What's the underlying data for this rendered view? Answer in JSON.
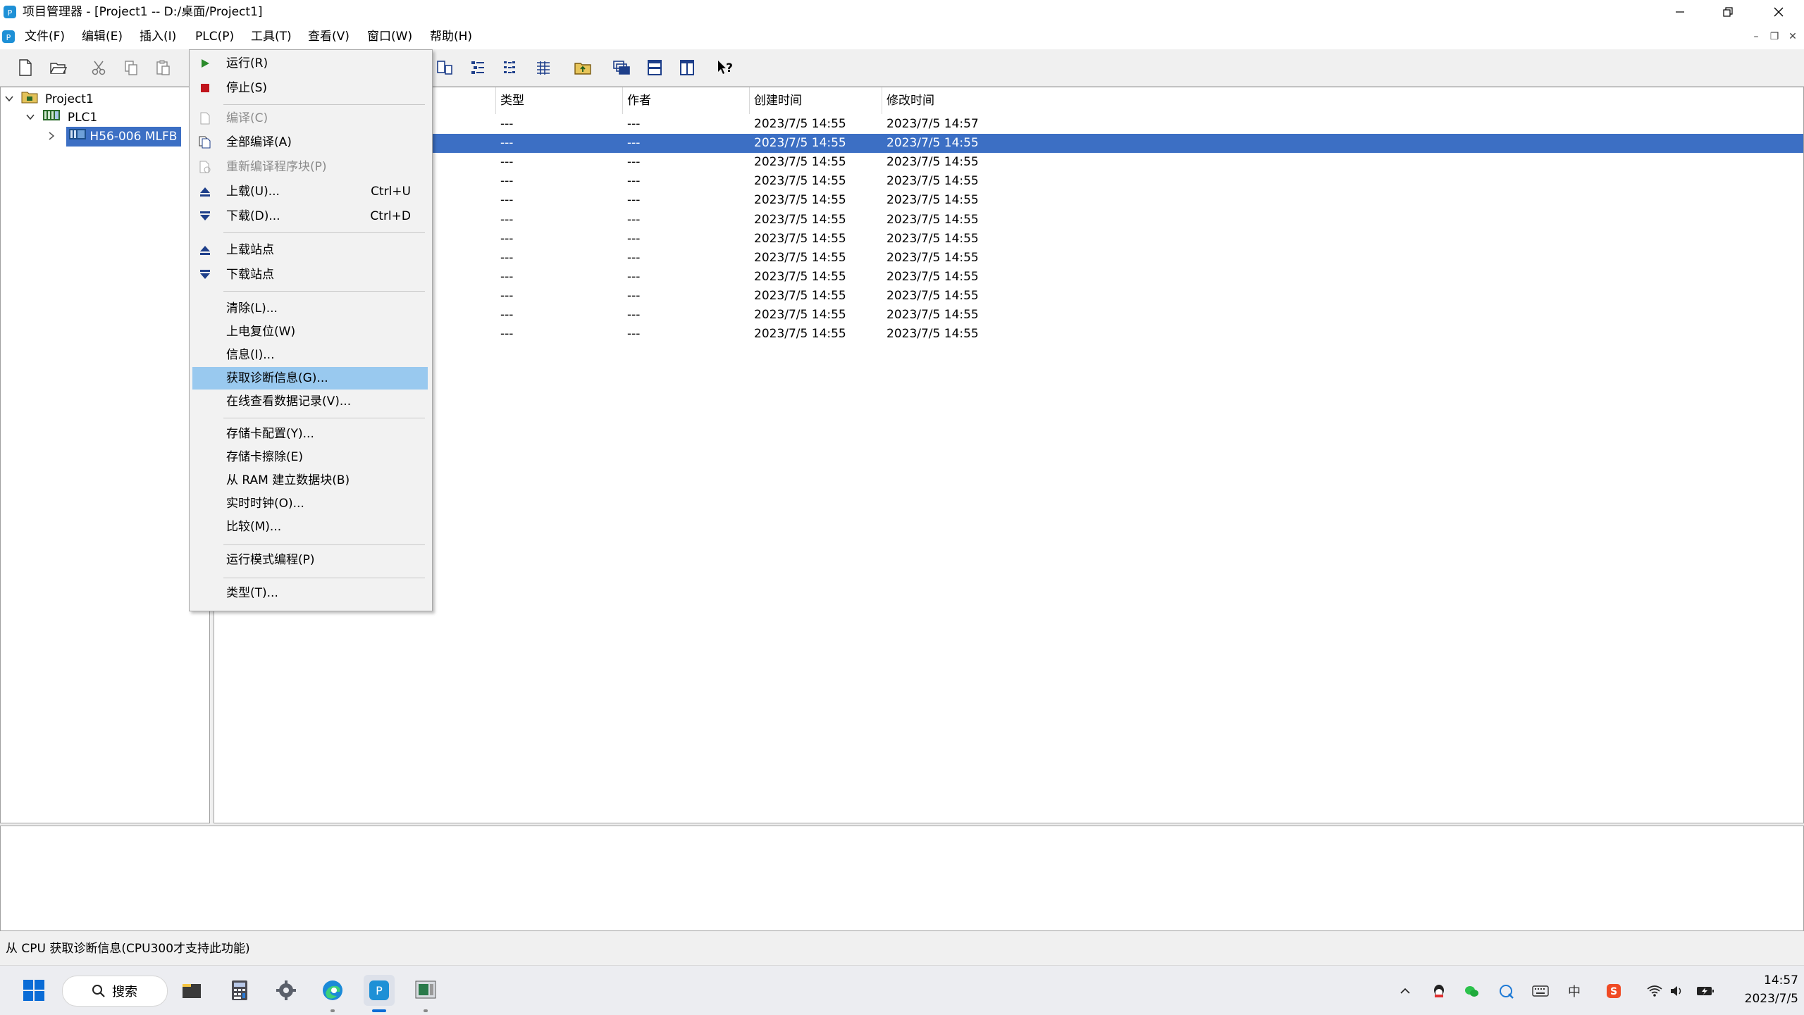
{
  "window": {
    "title": "项目管理器 - [Project1 -- D:/桌面/Project1]"
  },
  "menubar": [
    "文件(F)",
    "编辑(E)",
    "插入(I)",
    "PLC(P)",
    "工具(T)",
    "查看(V)",
    "窗口(W)",
    "帮助(H)"
  ],
  "tree": {
    "root": "Project1",
    "plc": "PLC1",
    "device": "H56-006 MLFB"
  },
  "list": {
    "columns": [
      "类型",
      "作者",
      "创建时间",
      "修改时间"
    ],
    "rows": [
      [
        "---",
        "---",
        "2023/7/5 14:55",
        "2023/7/5 14:57"
      ],
      [
        "---",
        "---",
        "2023/7/5 14:55",
        "2023/7/5 14:55"
      ],
      [
        "---",
        "---",
        "2023/7/5 14:55",
        "2023/7/5 14:55"
      ],
      [
        "---",
        "---",
        "2023/7/5 14:55",
        "2023/7/5 14:55"
      ],
      [
        "---",
        "---",
        "2023/7/5 14:55",
        "2023/7/5 14:55"
      ],
      [
        "---",
        "---",
        "2023/7/5 14:55",
        "2023/7/5 14:55"
      ],
      [
        "---",
        "---",
        "2023/7/5 14:55",
        "2023/7/5 14:55"
      ],
      [
        "---",
        "---",
        "2023/7/5 14:55",
        "2023/7/5 14:55"
      ],
      [
        "---",
        "---",
        "2023/7/5 14:55",
        "2023/7/5 14:55"
      ],
      [
        "---",
        "---",
        "2023/7/5 14:55",
        "2023/7/5 14:55"
      ],
      [
        "---",
        "---",
        "2023/7/5 14:55",
        "2023/7/5 14:55"
      ],
      [
        "---",
        "---",
        "2023/7/5 14:55",
        "2023/7/5 14:55"
      ]
    ],
    "selected_row": 1
  },
  "plc_menu": {
    "run": "运行(R)",
    "stop": "停止(S)",
    "compile": "编译(C)",
    "compile_all": "全部编译(A)",
    "recompile_blocks": "重新编译程序块(P)",
    "upload": "上载(U)...",
    "upload_shortcut": "Ctrl+U",
    "download": "下载(D)...",
    "download_shortcut": "Ctrl+D",
    "upload_station": "上载站点",
    "download_station": "下载站点",
    "clear": "清除(L)...",
    "power_reset": "上电复位(W)",
    "info": "信息(I)...",
    "diagnostics": "获取诊断信息(G)...",
    "online_data_log": "在线查看数据记录(V)...",
    "memory_card_config": "存储卡配置(Y)...",
    "memory_card_erase": "存储卡擦除(E)",
    "ram_to_db": "从 RAM 建立数据块(B)",
    "rtc": "实时时钟(O)...",
    "compare": "比较(M)...",
    "run_mode_edit": "运行模式编程(P)",
    "type": "类型(T)..."
  },
  "status_text": "从 CPU 获取诊断信息(CPU300才支持此功能)",
  "taskbar": {
    "search": "搜索",
    "time": "14:57",
    "date": "2023/7/5",
    "ime": "中"
  },
  "colors": {
    "selection": "#3c6fc4",
    "menu_highlight": "#99c9ef",
    "title_icon": "#1e90d6"
  }
}
